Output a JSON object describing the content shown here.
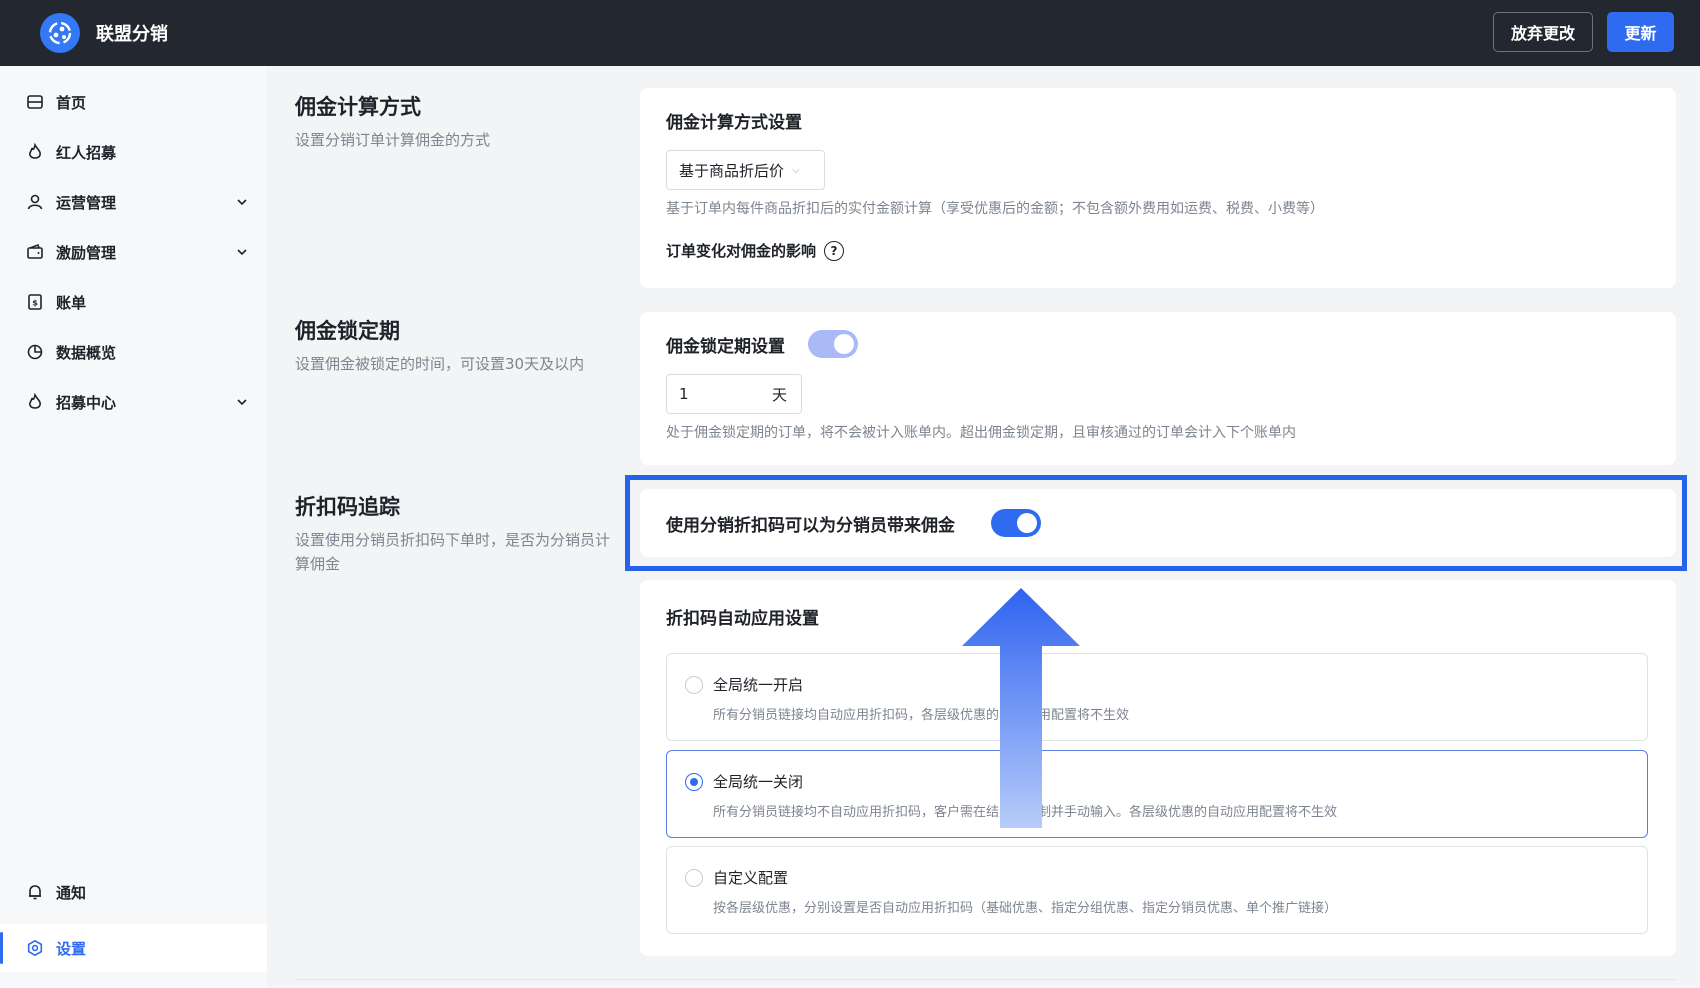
{
  "header": {
    "brand": "联盟分销",
    "discard_label": "放弃更改",
    "update_label": "更新",
    "accent_color": "#2f6bf0"
  },
  "sidebar": {
    "items": [
      {
        "label": "首页",
        "icon": "home-icon"
      },
      {
        "label": "红人招募",
        "icon": "flame-icon"
      },
      {
        "label": "运营管理",
        "icon": "user-icon",
        "expandable": true
      },
      {
        "label": "激励管理",
        "icon": "wallet-icon",
        "expandable": true
      },
      {
        "label": "账单",
        "icon": "bill-icon"
      },
      {
        "label": "数据概览",
        "icon": "pie-chart-icon"
      },
      {
        "label": "招募中心",
        "icon": "flame-icon",
        "expandable": true
      }
    ],
    "bottom": [
      {
        "label": "通知",
        "icon": "bell-icon"
      },
      {
        "label": "设置",
        "icon": "settings-icon",
        "active": true
      }
    ]
  },
  "sections": {
    "commission": {
      "title": "佣金计算方式",
      "desc": "设置分销订单计算佣金的方式",
      "card_title": "佣金计算方式设置",
      "select_value": "基于商品折后价",
      "hint": "基于订单内每件商品折扣后的实付金额计算（享受优惠后的金额；不包含额外费用如运费、税费、小费等）",
      "impact_label": "订单变化对佣金的影响",
      "help_glyph": "?"
    },
    "lock": {
      "title": "佣金锁定期",
      "desc": "设置佣金被锁定的时间，可设置30天及以内",
      "card_title": "佣金锁定期设置",
      "toggle_on": true,
      "days_value": "1",
      "days_unit": "天",
      "hint": "处于佣金锁定期的订单，将不会被计入账单内。超出佣金锁定期，且审核通过的订单会计入下个账单内"
    },
    "discount": {
      "title": "折扣码追踪",
      "desc": "设置使用分销员折扣码下单时，是否为分销员计算佣金",
      "toggle_label": "使用分销折扣码可以为分销员带来佣金",
      "toggle_on": true,
      "auto_title": "折扣码自动应用设置",
      "options": [
        {
          "title": "全局统一开启",
          "desc": "所有分销员链接均自动应用折扣码，各层级优惠的自动应用配置将不生效",
          "selected": false
        },
        {
          "title": "全局统一关闭",
          "desc": "所有分销员链接均不自动应用折扣码，客户需在结账时复制并手动输入。各层级优惠的自动应用配置将不生效",
          "selected": true
        },
        {
          "title": "自定义配置",
          "desc": "按各层级优惠，分别设置是否自动应用折扣码（基础优惠、指定分组优惠、指定分销员优惠、单个推广链接）",
          "selected": false
        }
      ]
    }
  }
}
